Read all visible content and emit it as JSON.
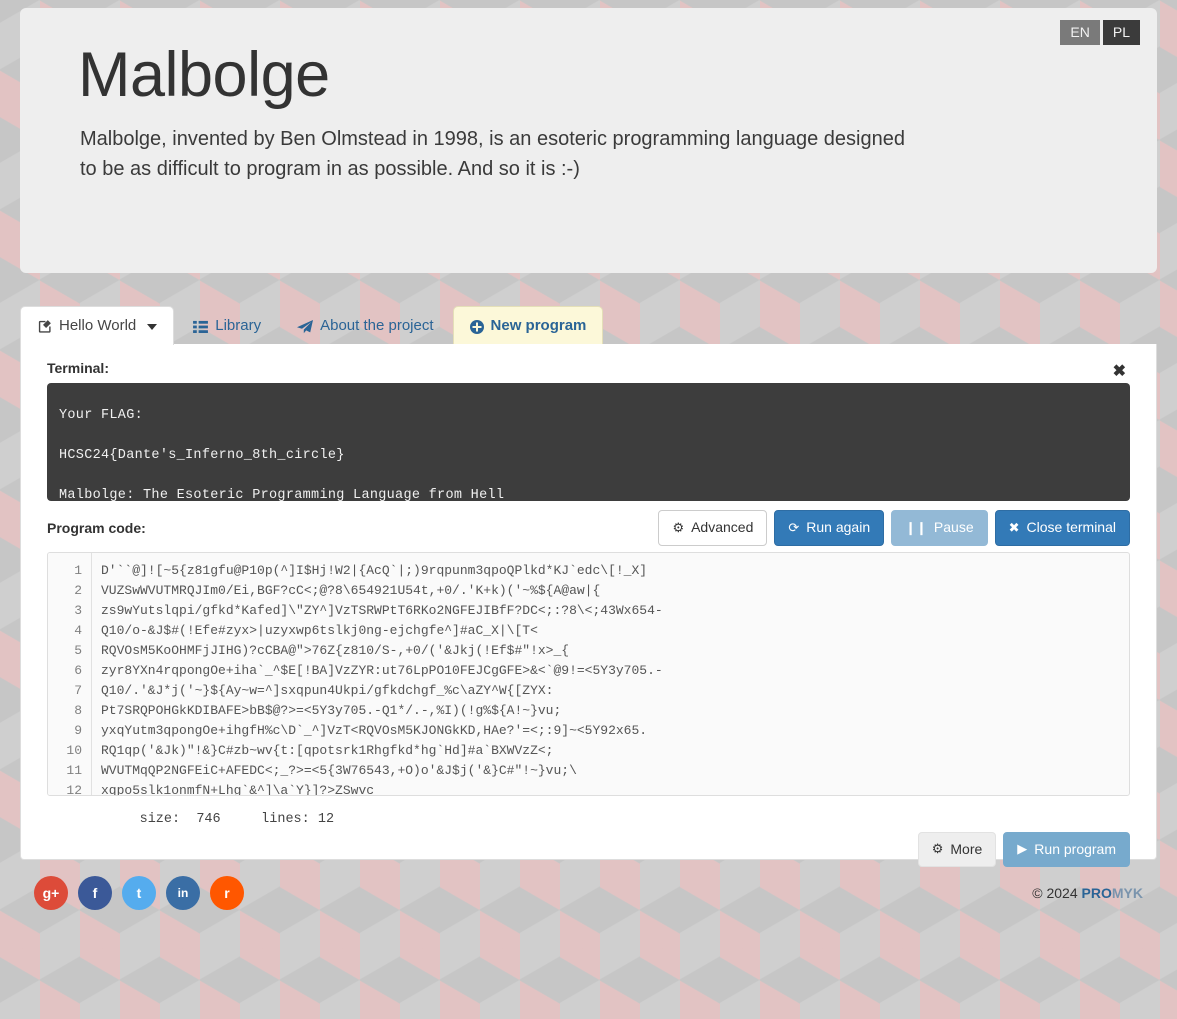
{
  "lang": {
    "en": "EN",
    "pl": "PL",
    "active": "EN"
  },
  "header": {
    "title": "Malbolge",
    "description": "Malbolge, invented by Ben Olmstead in 1998, is an esoteric programming language designed to be as difficult to program in as possible. And so it is :-)"
  },
  "tabs": [
    {
      "label": "Hello World",
      "icon": "edit-icon",
      "state": "active"
    },
    {
      "label": "Library",
      "icon": "list-icon",
      "state": "normal"
    },
    {
      "label": "About the project",
      "icon": "paper-plane-icon",
      "state": "normal"
    },
    {
      "label": "New program",
      "icon": "plus-circle-icon",
      "state": "highlight"
    }
  ],
  "terminal": {
    "label": "Terminal:",
    "close_icon": "close-icon",
    "lines": [
      "Your FLAG:",
      "HCSC24{Dante's_Inferno_8th_circle}",
      "Malbolge: The Esoteric Programming Language from Hell"
    ]
  },
  "terminal_actions": [
    {
      "label": "Advanced",
      "icon": "gear-icon",
      "style": "default"
    },
    {
      "label": "Run again",
      "icon": "refresh-icon",
      "style": "primary"
    },
    {
      "label": "Pause",
      "icon": "pause-icon",
      "style": "muted"
    },
    {
      "label": "Close terminal",
      "icon": "close-icon",
      "style": "primary"
    }
  ],
  "code": {
    "label": "Program code:",
    "line_numbers": [
      "1",
      "2",
      "3",
      "4",
      "5",
      "6",
      "7",
      "8",
      "9",
      "10",
      "11",
      "12"
    ],
    "lines": [
      "D'``@]![~5{z81gfu@P10p(^]I$Hj!W2|{AcQ`|;)9rqpunm3qpoQPlkd*KJ`edc\\[!_X]",
      "VUZSwWVUTMRQJIm0/Ei,BGF?cC<;@?8\\654921U54t,+0/.'K+k)('~%${A@aw|{",
      "zs9wYutslqpi/gfkd*Kafed]\\\"ZY^]VzTSRWPtT6RKo2NGFEJIBfF?DC<;:?8\\<;43Wx654-",
      "Q10/o-&J$#(!Efe#zyx>|uzyxwp6tslkj0ng-ejchgfe^]#aC_X|\\[T<",
      "RQVOsM5KoOHMFjJIHG)?cCBA@\">76Z{z810/S-,+0/('&Jkj(!Ef$#\"!x>_{",
      "zyr8YXn4rqpongOe+iha`_^$E[!BA]VzZYR:ut76LpPO10FEJCgGFE>&<`@9!=<5Y3y705.-",
      "Q10/.'&J*j('~}${Ay~w=^]sxqpun4Ukpi/gfkdchgf_%c\\aZY^W{[ZYX:",
      "Pt7SRQPOHGkKDIBAFE>bB$@?>=<5Y3y705.-Q1*/.-,%I)(!g%${A!~}vu;",
      "yxqYutm3qpongOe+ihgfH%c\\D`_^]VzT<RQVOsM5KJONGkKD,HAe?'=<;:9]~<5Y92x65.",
      "RQ1qp('&Jk)\"!&}C#zb~wv{t:[qpotsrk1Rhgfkd*hg`Hd]#a`BXWVzZ<;",
      "WVUTMqQP2NGFEiC+AFEDC<;_?>=<5{3W76543,+O)o'&J$j('&}C#\"!~}vu;\\",
      "xqpo5slk1onmfN+Lhg`&^]\\a`Y}]?>ZSwvc"
    ],
    "size_label": "size:",
    "size_value": "746",
    "lines_label": "lines:",
    "lines_value": "12"
  },
  "code_actions": [
    {
      "label": "More",
      "icon": "gear-icon",
      "style": "light"
    },
    {
      "label": "Run program",
      "icon": "play-icon",
      "style": "run"
    }
  ],
  "footer": {
    "social": [
      {
        "name": "google-plus",
        "glyph": "g+"
      },
      {
        "name": "facebook",
        "glyph": "f"
      },
      {
        "name": "twitter",
        "glyph": "t"
      },
      {
        "name": "linkedin",
        "glyph": "in"
      },
      {
        "name": "rss",
        "glyph": "r"
      }
    ],
    "copyright_prefix": "© 2024 ",
    "brand_bold": "PRO",
    "brand_light": "MYK"
  },
  "colors": {
    "primary": "#337ab7",
    "muted": "#93b9d6",
    "run": "#77aacd",
    "terminal_bg": "#3d3d3d",
    "highlight_tab": "#fcf8d9"
  }
}
